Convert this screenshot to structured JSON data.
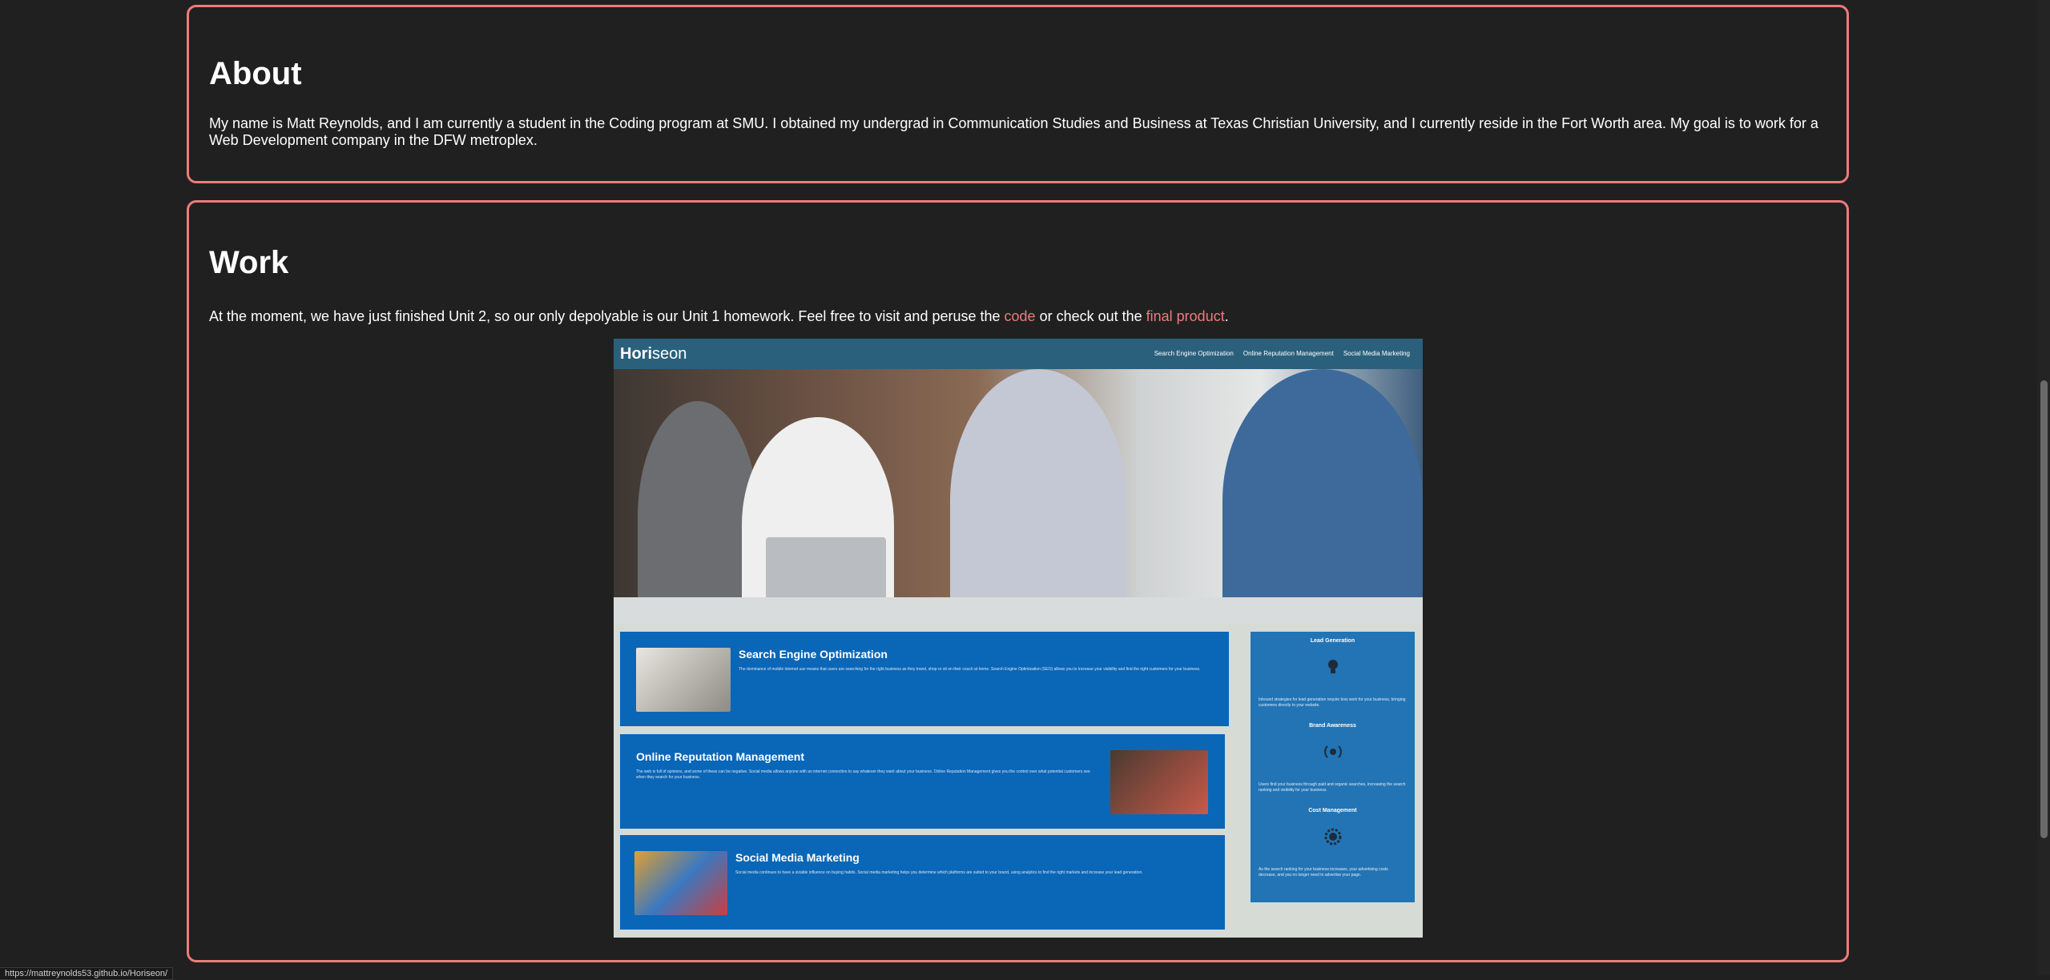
{
  "about": {
    "heading": "About",
    "text": "My name is Matt Reynolds, and I am currently a student in the Coding program at SMU. I obtained my undergrad in Communication Studies and Business at Texas Christian University, and I currently reside in the Fort Worth area. My goal is to work for a Web Development company in the DFW metroplex."
  },
  "work": {
    "heading": "Work",
    "text_before": "At the moment, we have just finished Unit 2, so our only depolyable is our Unit 1 homework. Feel free to visit and peruse the ",
    "code_link": "code",
    "text_middle": " or check out the ",
    "product_link": "final product",
    "text_after": "."
  },
  "preview": {
    "logo_bold": "Hori",
    "logo_light": "seon",
    "nav": [
      "Search Engine Optimization",
      "Online Reputation Management",
      "Social Media Marketing"
    ],
    "boxes": [
      {
        "title": "Search Engine Optimization",
        "text": "The dominance of mobile internet use means that users are searching for the right business as they travel, shop or sit on their couch at home. Search Engine Optimization (SEO) allows you to increase your visibility and find the right customers for your business."
      },
      {
        "title": "Online Reputation Management",
        "text": "The web is full of opinions, and some of these can be negative. Social media allows anyone with an internet connection to say whatever they want about your business. Online Reputation Management gives you the control over what potential customers see when they search for your business."
      },
      {
        "title": "Social Media Marketing",
        "text": "Social media continues to have a sizable influence on buying habits. Social media marketing helps you determine which platforms are suited to your brand, using analytics to find the right markets and increase your lead generation."
      }
    ],
    "sidebar": [
      {
        "title": "Lead Generation",
        "text": "Inbound strategies for lead generation require less work for your business, bringing customers directly to your website."
      },
      {
        "title": "Brand Awareness",
        "text": "Users find your business through paid and organic searches, increasing the search ranking and visibility for your business."
      },
      {
        "title": "Cost Management",
        "text": "As the search ranking for your business increases, your advertising costs decrease, and you no longer need to advertise your page."
      }
    ]
  },
  "status_url": "https://mattreynolds53.github.io/Horiseon/",
  "colors": {
    "accent": "#f07b7b",
    "background": "#202020"
  }
}
